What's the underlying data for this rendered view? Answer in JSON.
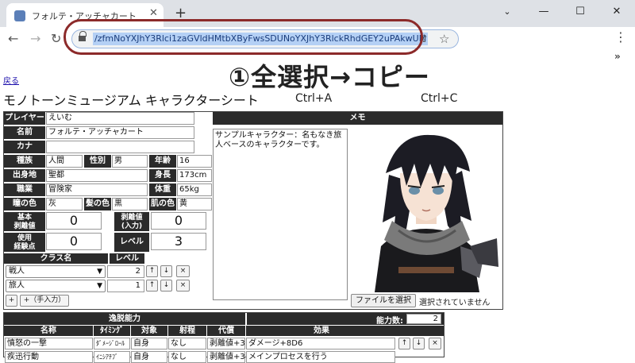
{
  "browser": {
    "tab_title": "フォルテ・アッチャカート",
    "tab_close": "✕",
    "new_tab": "+",
    "window_controls": {
      "minimize": "—",
      "maximize": "☐",
      "close": "✕",
      "tabsearch": "⌄"
    },
    "url": "/zfmNoYXJhY3Rlci1zaGVldHMtbXByFwsSDUNoYXJhY3RlckRhdGEY2uPAkwUM",
    "nav": {
      "back": "←",
      "forward": "→",
      "reload": "↻"
    },
    "star": "☆",
    "share": "⇪",
    "menu": "⋮",
    "extensions": "»"
  },
  "annotation": {
    "main": "①全選択→コピー",
    "sub1": "Ctrl+A",
    "sub2": "Ctrl+C",
    "oval_color": "#8c2a2a"
  },
  "page": {
    "back_link": "戻る",
    "title": "モノトーンミュージアム キャラクターシート"
  },
  "profile": {
    "player_label": "プレイヤー",
    "player": "えいむ",
    "name_label": "名前",
    "name": "フォルテ・アッチャカート",
    "kana_label": "カナ",
    "kana": "",
    "race_label": "種族",
    "race": "人間",
    "sex_label": "性別",
    "sex": "男",
    "age_label": "年齢",
    "age": "16",
    "origin_label": "出身地",
    "origin": "聖都",
    "height_label": "身長",
    "height": "173cm",
    "job_label": "職業",
    "job": "冒険家",
    "weight_label": "体重",
    "weight": "65kg",
    "eye_label": "瞳の色",
    "eye": "灰",
    "hair_label": "髪の色",
    "hair": "黒",
    "skin_label": "肌の色",
    "skin": "黄",
    "base_label": "基本\n剥離値",
    "base": "0",
    "peel_input_label": "剥離値\n(入力)",
    "peel_input": "0",
    "exp_label": "使用\n経験点",
    "exp": "0",
    "level_label": "レベル",
    "level": "3"
  },
  "classes": {
    "header_name": "クラス名",
    "header_level": "レベル",
    "rows": [
      {
        "name": "戦人",
        "level": "2"
      },
      {
        "name": "旅人",
        "level": "1"
      }
    ],
    "up": "↑",
    "down": "↓",
    "del": "×",
    "add": "+",
    "add_manual": "+（手入力）"
  },
  "memo": {
    "header": "メモ",
    "text": "サンプルキャラクター：名もなき旅人ベースのキャラクターです。",
    "file_button": "ファイルを選択",
    "file_status": "選択されていません"
  },
  "skills": {
    "section": "逸脱能力",
    "count_label": "能力数:",
    "count": "2",
    "headers": {
      "name": "名称",
      "timing": "ﾀｲﾐﾝｸﾞ",
      "target": "対象",
      "range": "射程",
      "cost": "代償",
      "effect": "効果"
    },
    "rows": [
      {
        "name": "憤怒の一撃",
        "timing": "ﾀﾞﾒｰｼﾞﾛｰﾙ",
        "target": "自身",
        "range": "なし",
        "cost": "剥離値+3",
        "effect": "ダメージ+8D6"
      },
      {
        "name": "疾迅行動",
        "timing": "ｲﾆｼｱﾁﾌﾞ",
        "target": "自身",
        "range": "なし",
        "cost": "剥離値+3",
        "effect": "メインプロセスを行う"
      }
    ]
  }
}
